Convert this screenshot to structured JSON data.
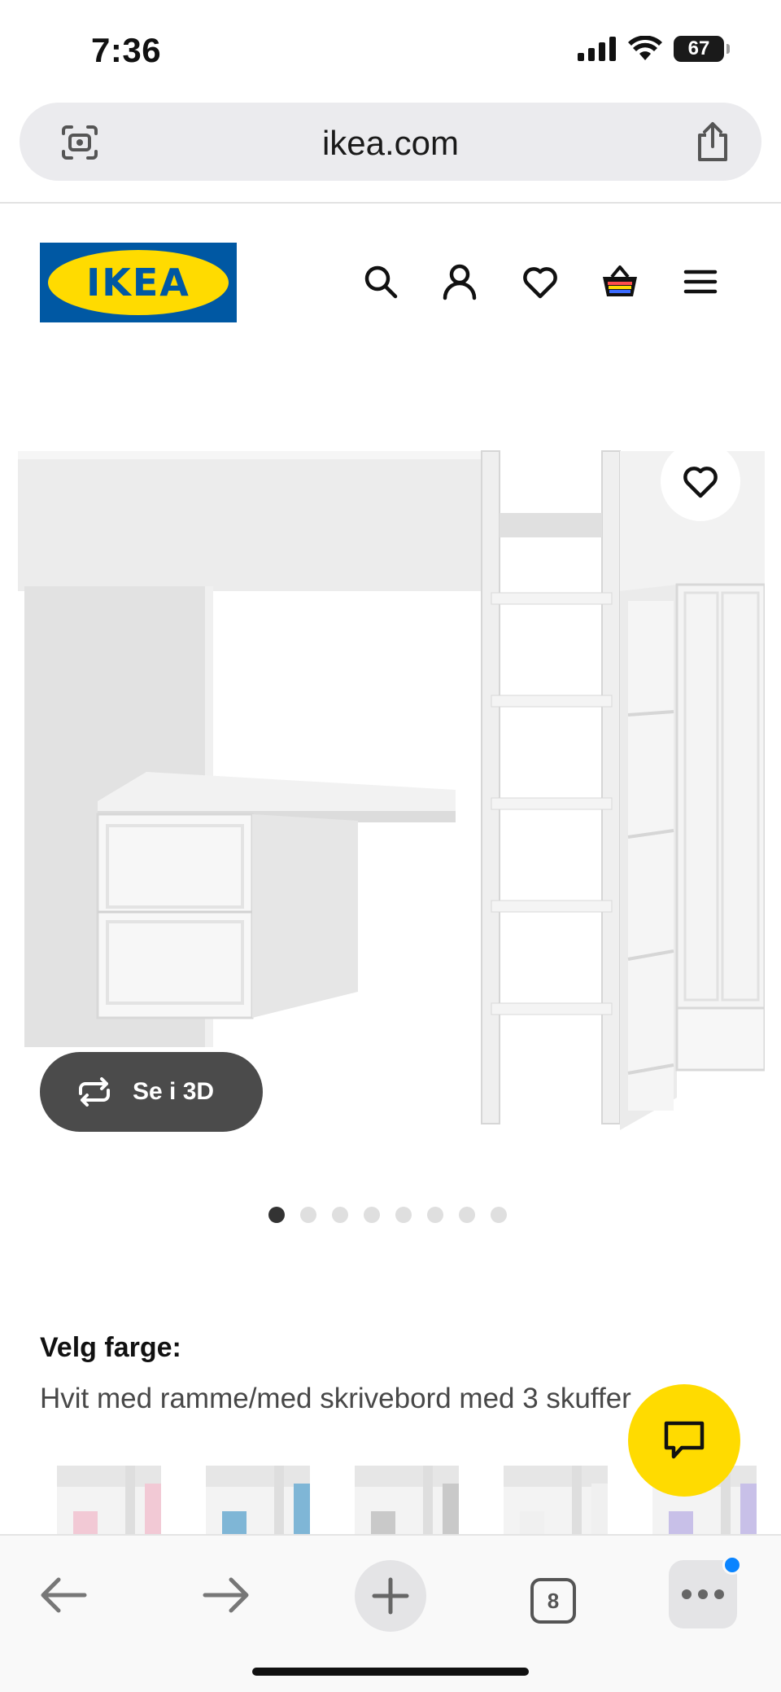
{
  "status_bar": {
    "time": "7:36",
    "battery": "67",
    "icons": [
      "signal-icon",
      "wifi-icon",
      "battery-icon"
    ]
  },
  "browser": {
    "url": "ikea.com",
    "open_tabs": "8",
    "icons": [
      "lens-icon",
      "share-icon",
      "back-icon",
      "forward-icon",
      "new-tab-icon",
      "tabs-icon",
      "more-icon"
    ]
  },
  "header": {
    "logo_text": "IKEA",
    "icons": [
      "search-icon",
      "account-icon",
      "heart-icon",
      "basket-icon",
      "menu-icon"
    ]
  },
  "product": {
    "view_3d_label": "Se i 3D",
    "image_count": 8,
    "active_image": 1,
    "color_heading": "Velg farge:",
    "color_value": "Hvit med ramme/med skrivebord med 3 skuffer",
    "swatches": [
      {
        "accent": "#f2c9d5"
      },
      {
        "accent": "#7fb6d6"
      },
      {
        "accent": "#c9c9c9"
      },
      {
        "accent": "#f0f0f0"
      },
      {
        "accent": "#c8c0e8"
      }
    ]
  },
  "colors": {
    "ikea_blue": "#0058a3",
    "ikea_yellow": "#ffdb00",
    "button_dark": "#4b4b4b",
    "notification_blue": "#0a84ff"
  }
}
